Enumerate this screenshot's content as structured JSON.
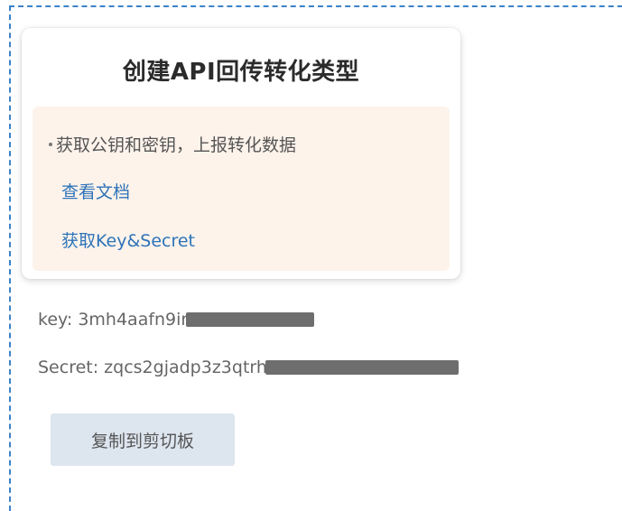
{
  "card": {
    "title": "创建API回传转化类型",
    "description": "获取公钥和密钥，上报转化数据",
    "links": {
      "view_docs": "查看文档",
      "get_key_secret": "获取Key&Secret"
    }
  },
  "credentials": {
    "key_text": "key: 3mh4aafn9ir",
    "secret_text": "Secret: zqcs2gjadp3z3qtrh"
  },
  "actions": {
    "copy_label": "复制到剪切板"
  },
  "colors": {
    "frame_border": "#3c82c8",
    "panel_background": "#fdf3eb",
    "link": "#2e73b8",
    "button_background": "#dde5ef"
  }
}
